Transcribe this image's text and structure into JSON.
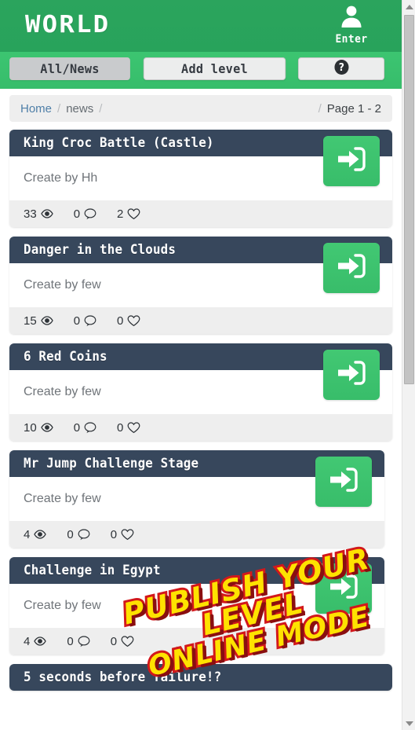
{
  "header": {
    "logo": "WORLD",
    "user_icon": "user-avatar-icon",
    "user_label": "Enter"
  },
  "tabs": [
    {
      "label": "All/News",
      "name": "tab-all-news",
      "active": true
    },
    {
      "label": "Add level",
      "name": "tab-add-level",
      "active": false
    },
    {
      "label": "",
      "name": "tab-help",
      "icon": "question-mark-icon",
      "active": false
    }
  ],
  "breadcrumb": {
    "home": "Home",
    "sep1": "/",
    "section": "news",
    "sep2": "/",
    "sep3": "/",
    "page": "Page 1 - 2"
  },
  "cards": [
    {
      "title": "King Croc Battle (Castle)",
      "author": "Create by Hh",
      "views": "33",
      "comments": "0",
      "likes": "2",
      "enter_icon": "sign-in-arrow-icon"
    },
    {
      "title": "Danger in the Clouds",
      "author": "Create by few",
      "views": "15",
      "comments": "0",
      "likes": "0",
      "enter_icon": "sign-in-arrow-icon"
    },
    {
      "title": "6 Red Coins",
      "author": "Create by few",
      "views": "10",
      "comments": "0",
      "likes": "0",
      "enter_icon": "sign-in-arrow-icon"
    },
    {
      "title": "Mr Jump Challenge Stage",
      "author": "Create by few",
      "views": "4",
      "comments": "0",
      "likes": "0",
      "enter_icon": "sign-in-arrow-icon"
    },
    {
      "title": "Challenge in Egypt",
      "author": "Create by few",
      "views": "4",
      "comments": "0",
      "likes": "0",
      "enter_icon": "sign-in-arrow-icon"
    },
    {
      "title": "5 seconds before failure!?",
      "author": "",
      "views": "",
      "comments": "",
      "likes": "",
      "enter_icon": "sign-in-arrow-icon"
    }
  ],
  "watermark": {
    "line1": "PUBLISH YOUR LEVEL",
    "line2": "ONLINE MODE",
    "fill_color": "#ffe200",
    "stroke_color": "#d2181b"
  },
  "colors": {
    "header_green": "#2aa65c",
    "tabbar_green": "#3bc46f",
    "card_header": "#37475c",
    "accent_green": "#3ec46f",
    "footer_gray": "#eeeeee"
  }
}
